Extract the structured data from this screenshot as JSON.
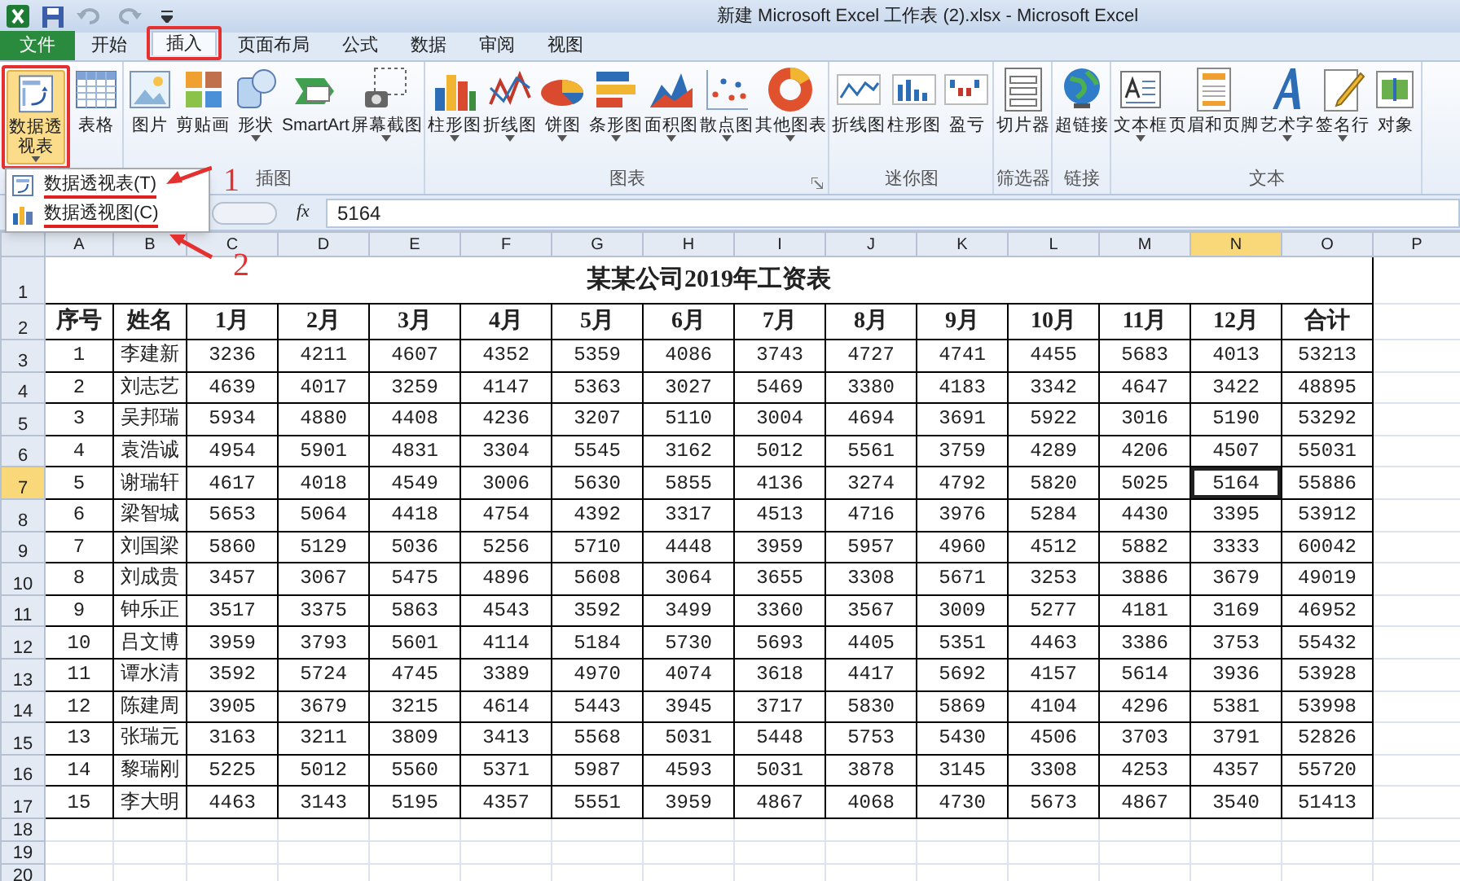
{
  "window": {
    "title": "新建 Microsoft Excel 工作表 (2).xlsx  -  Microsoft Excel"
  },
  "tabs": [
    {
      "label": "文件",
      "kind": "file",
      "selected": false
    },
    {
      "label": "开始",
      "kind": "tab",
      "selected": false
    },
    {
      "label": "插入",
      "kind": "tab",
      "selected": true
    },
    {
      "label": "页面布局",
      "kind": "tab",
      "selected": false
    },
    {
      "label": "公式",
      "kind": "tab",
      "selected": false
    },
    {
      "label": "数据",
      "kind": "tab",
      "selected": false
    },
    {
      "label": "审阅",
      "kind": "tab",
      "selected": false
    },
    {
      "label": "视图",
      "kind": "tab",
      "selected": false
    }
  ],
  "ribbon": {
    "groups": [
      {
        "buttons": [
          {
            "label": "数据透视表",
            "dropdown": true,
            "pressed": true
          },
          {
            "label": "表格",
            "dropdown": false,
            "pressed": false
          }
        ]
      },
      {
        "label": "插图",
        "buttons": [
          {
            "label": "图片",
            "dropdown": false,
            "pressed": false
          },
          {
            "label": "剪贴画",
            "dropdown": false,
            "pressed": false
          },
          {
            "label": "形状",
            "dropdown": true,
            "pressed": false
          },
          {
            "label": "SmartArt",
            "dropdown": false,
            "pressed": false
          },
          {
            "label": "屏幕截图",
            "dropdown": true,
            "pressed": false
          }
        ]
      },
      {
        "label": "图表",
        "launcher": true,
        "buttons": [
          {
            "label": "柱形图",
            "dropdown": true,
            "pressed": false
          },
          {
            "label": "折线图",
            "dropdown": true,
            "pressed": false
          },
          {
            "label": "饼图",
            "dropdown": true,
            "pressed": false
          },
          {
            "label": "条形图",
            "dropdown": true,
            "pressed": false
          },
          {
            "label": "面积图",
            "dropdown": true,
            "pressed": false
          },
          {
            "label": "散点图",
            "dropdown": true,
            "pressed": false
          },
          {
            "label": "其他图表",
            "dropdown": true,
            "pressed": false
          }
        ]
      },
      {
        "label": "迷你图",
        "buttons": [
          {
            "label": "折线图",
            "dropdown": false,
            "pressed": false
          },
          {
            "label": "柱形图",
            "dropdown": false,
            "pressed": false
          },
          {
            "label": "盈亏",
            "dropdown": false,
            "pressed": false
          }
        ]
      },
      {
        "label": "筛选器",
        "buttons": [
          {
            "label": "切片器",
            "dropdown": false,
            "pressed": false
          }
        ]
      },
      {
        "label": "链接",
        "buttons": [
          {
            "label": "超链接",
            "dropdown": false,
            "pressed": false
          }
        ]
      },
      {
        "label": "文本",
        "buttons": [
          {
            "label": "文本框",
            "dropdown": true,
            "pressed": false
          },
          {
            "label": "页眉和页脚",
            "dropdown": false,
            "pressed": false
          },
          {
            "label": "艺术字",
            "dropdown": true,
            "pressed": false
          },
          {
            "label": "签名行",
            "dropdown": true,
            "pressed": false
          },
          {
            "label": "对象",
            "dropdown": false,
            "pressed": false
          }
        ]
      }
    ]
  },
  "dropdown_menu": {
    "items": [
      {
        "label": "数据透视表(T)"
      },
      {
        "label": "数据透视图(C)"
      }
    ]
  },
  "annotations": [
    {
      "label": "1"
    },
    {
      "label": "2"
    }
  ],
  "formula_bar": {
    "function_label": "fx",
    "value": "5164"
  },
  "sheet": {
    "column_headers": [
      {
        "label": "A",
        "selected": false
      },
      {
        "label": "B",
        "selected": false
      },
      {
        "label": "C",
        "selected": false
      },
      {
        "label": "D",
        "selected": false
      },
      {
        "label": "E",
        "selected": false
      },
      {
        "label": "F",
        "selected": false
      },
      {
        "label": "G",
        "selected": false
      },
      {
        "label": "H",
        "selected": false
      },
      {
        "label": "I",
        "selected": false
      },
      {
        "label": "J",
        "selected": false
      },
      {
        "label": "K",
        "selected": false
      },
      {
        "label": "L",
        "selected": false
      },
      {
        "label": "M",
        "selected": false
      },
      {
        "label": "N",
        "selected": true
      },
      {
        "label": "O",
        "selected": false
      },
      {
        "label": "P",
        "selected": false
      }
    ],
    "row_headers": [
      {
        "label": "1",
        "selected": false
      },
      {
        "label": "2",
        "selected": false
      },
      {
        "label": "3",
        "selected": false
      },
      {
        "label": "4",
        "selected": false
      },
      {
        "label": "5",
        "selected": false
      },
      {
        "label": "6",
        "selected": false
      },
      {
        "label": "7",
        "selected": true
      },
      {
        "label": "8",
        "selected": false
      },
      {
        "label": "9",
        "selected": false
      },
      {
        "label": "10",
        "selected": false
      },
      {
        "label": "11",
        "selected": false
      },
      {
        "label": "12",
        "selected": false
      },
      {
        "label": "13",
        "selected": false
      },
      {
        "label": "14",
        "selected": false
      },
      {
        "label": "15",
        "selected": false
      },
      {
        "label": "16",
        "selected": false
      },
      {
        "label": "17",
        "selected": false
      },
      {
        "label": "18",
        "selected": false
      },
      {
        "label": "19",
        "selected": false
      },
      {
        "label": "20",
        "selected": false
      }
    ],
    "title": "某某公司2019年工资表",
    "header_row": [
      "序号",
      "姓名",
      "1月",
      "2月",
      "3月",
      "4月",
      "5月",
      "6月",
      "7月",
      "8月",
      "9月",
      "10月",
      "11月",
      "12月",
      "合计"
    ],
    "rows": [
      {
        "cells": [
          {
            "text": "1",
            "selected": false
          },
          {
            "text": "李建新",
            "selected": false
          },
          {
            "text": "3236",
            "selected": false
          },
          {
            "text": "4211",
            "selected": false
          },
          {
            "text": "4607",
            "selected": false
          },
          {
            "text": "4352",
            "selected": false
          },
          {
            "text": "5359",
            "selected": false
          },
          {
            "text": "4086",
            "selected": false
          },
          {
            "text": "3743",
            "selected": false
          },
          {
            "text": "4727",
            "selected": false
          },
          {
            "text": "4741",
            "selected": false
          },
          {
            "text": "4455",
            "selected": false
          },
          {
            "text": "5683",
            "selected": false
          },
          {
            "text": "4013",
            "selected": false
          },
          {
            "text": "53213",
            "selected": false
          }
        ]
      },
      {
        "cells": [
          {
            "text": "2",
            "selected": false
          },
          {
            "text": "刘志艺",
            "selected": false
          },
          {
            "text": "4639",
            "selected": false
          },
          {
            "text": "4017",
            "selected": false
          },
          {
            "text": "3259",
            "selected": false
          },
          {
            "text": "4147",
            "selected": false
          },
          {
            "text": "5363",
            "selected": false
          },
          {
            "text": "3027",
            "selected": false
          },
          {
            "text": "5469",
            "selected": false
          },
          {
            "text": "3380",
            "selected": false
          },
          {
            "text": "4183",
            "selected": false
          },
          {
            "text": "3342",
            "selected": false
          },
          {
            "text": "4647",
            "selected": false
          },
          {
            "text": "3422",
            "selected": false
          },
          {
            "text": "48895",
            "selected": false
          }
        ]
      },
      {
        "cells": [
          {
            "text": "3",
            "selected": false
          },
          {
            "text": "吴邦瑞",
            "selected": false
          },
          {
            "text": "5934",
            "selected": false
          },
          {
            "text": "4880",
            "selected": false
          },
          {
            "text": "4408",
            "selected": false
          },
          {
            "text": "4236",
            "selected": false
          },
          {
            "text": "3207",
            "selected": false
          },
          {
            "text": "5110",
            "selected": false
          },
          {
            "text": "3004",
            "selected": false
          },
          {
            "text": "4694",
            "selected": false
          },
          {
            "text": "3691",
            "selected": false
          },
          {
            "text": "5922",
            "selected": false
          },
          {
            "text": "3016",
            "selected": false
          },
          {
            "text": "5190",
            "selected": false
          },
          {
            "text": "53292",
            "selected": false
          }
        ]
      },
      {
        "cells": [
          {
            "text": "4",
            "selected": false
          },
          {
            "text": "袁浩诚",
            "selected": false
          },
          {
            "text": "4954",
            "selected": false
          },
          {
            "text": "5901",
            "selected": false
          },
          {
            "text": "4831",
            "selected": false
          },
          {
            "text": "3304",
            "selected": false
          },
          {
            "text": "5545",
            "selected": false
          },
          {
            "text": "3162",
            "selected": false
          },
          {
            "text": "5012",
            "selected": false
          },
          {
            "text": "5561",
            "selected": false
          },
          {
            "text": "3759",
            "selected": false
          },
          {
            "text": "4289",
            "selected": false
          },
          {
            "text": "4206",
            "selected": false
          },
          {
            "text": "4507",
            "selected": false
          },
          {
            "text": "55031",
            "selected": false
          }
        ]
      },
      {
        "cells": [
          {
            "text": "5",
            "selected": false
          },
          {
            "text": "谢瑞轩",
            "selected": false
          },
          {
            "text": "4617",
            "selected": false
          },
          {
            "text": "4018",
            "selected": false
          },
          {
            "text": "4549",
            "selected": false
          },
          {
            "text": "3006",
            "selected": false
          },
          {
            "text": "5630",
            "selected": false
          },
          {
            "text": "5855",
            "selected": false
          },
          {
            "text": "4136",
            "selected": false
          },
          {
            "text": "3274",
            "selected": false
          },
          {
            "text": "4792",
            "selected": false
          },
          {
            "text": "5820",
            "selected": false
          },
          {
            "text": "5025",
            "selected": false
          },
          {
            "text": "5164",
            "selected": true
          },
          {
            "text": "55886",
            "selected": false
          }
        ]
      },
      {
        "cells": [
          {
            "text": "6",
            "selected": false
          },
          {
            "text": "梁智城",
            "selected": false
          },
          {
            "text": "5653",
            "selected": false
          },
          {
            "text": "5064",
            "selected": false
          },
          {
            "text": "4418",
            "selected": false
          },
          {
            "text": "4754",
            "selected": false
          },
          {
            "text": "4392",
            "selected": false
          },
          {
            "text": "3317",
            "selected": false
          },
          {
            "text": "4513",
            "selected": false
          },
          {
            "text": "4716",
            "selected": false
          },
          {
            "text": "3976",
            "selected": false
          },
          {
            "text": "5284",
            "selected": false
          },
          {
            "text": "4430",
            "selected": false
          },
          {
            "text": "3395",
            "selected": false
          },
          {
            "text": "53912",
            "selected": false
          }
        ]
      },
      {
        "cells": [
          {
            "text": "7",
            "selected": false
          },
          {
            "text": "刘国梁",
            "selected": false
          },
          {
            "text": "5860",
            "selected": false
          },
          {
            "text": "5129",
            "selected": false
          },
          {
            "text": "5036",
            "selected": false
          },
          {
            "text": "5256",
            "selected": false
          },
          {
            "text": "5710",
            "selected": false
          },
          {
            "text": "4448",
            "selected": false
          },
          {
            "text": "3959",
            "selected": false
          },
          {
            "text": "5957",
            "selected": false
          },
          {
            "text": "4960",
            "selected": false
          },
          {
            "text": "4512",
            "selected": false
          },
          {
            "text": "5882",
            "selected": false
          },
          {
            "text": "3333",
            "selected": false
          },
          {
            "text": "60042",
            "selected": false
          }
        ]
      },
      {
        "cells": [
          {
            "text": "8",
            "selected": false
          },
          {
            "text": "刘成贵",
            "selected": false
          },
          {
            "text": "3457",
            "selected": false
          },
          {
            "text": "3067",
            "selected": false
          },
          {
            "text": "5475",
            "selected": false
          },
          {
            "text": "4896",
            "selected": false
          },
          {
            "text": "5608",
            "selected": false
          },
          {
            "text": "3064",
            "selected": false
          },
          {
            "text": "3655",
            "selected": false
          },
          {
            "text": "3308",
            "selected": false
          },
          {
            "text": "5671",
            "selected": false
          },
          {
            "text": "3253",
            "selected": false
          },
          {
            "text": "3886",
            "selected": false
          },
          {
            "text": "3679",
            "selected": false
          },
          {
            "text": "49019",
            "selected": false
          }
        ]
      },
      {
        "cells": [
          {
            "text": "9",
            "selected": false
          },
          {
            "text": "钟乐正",
            "selected": false
          },
          {
            "text": "3517",
            "selected": false
          },
          {
            "text": "3375",
            "selected": false
          },
          {
            "text": "5863",
            "selected": false
          },
          {
            "text": "4543",
            "selected": false
          },
          {
            "text": "3592",
            "selected": false
          },
          {
            "text": "3499",
            "selected": false
          },
          {
            "text": "3360",
            "selected": false
          },
          {
            "text": "3567",
            "selected": false
          },
          {
            "text": "3009",
            "selected": false
          },
          {
            "text": "5277",
            "selected": false
          },
          {
            "text": "4181",
            "selected": false
          },
          {
            "text": "3169",
            "selected": false
          },
          {
            "text": "46952",
            "selected": false
          }
        ]
      },
      {
        "cells": [
          {
            "text": "10",
            "selected": false
          },
          {
            "text": "吕文博",
            "selected": false
          },
          {
            "text": "3959",
            "selected": false
          },
          {
            "text": "3793",
            "selected": false
          },
          {
            "text": "5601",
            "selected": false
          },
          {
            "text": "4114",
            "selected": false
          },
          {
            "text": "5184",
            "selected": false
          },
          {
            "text": "5730",
            "selected": false
          },
          {
            "text": "5693",
            "selected": false
          },
          {
            "text": "4405",
            "selected": false
          },
          {
            "text": "5351",
            "selected": false
          },
          {
            "text": "4463",
            "selected": false
          },
          {
            "text": "3386",
            "selected": false
          },
          {
            "text": "3753",
            "selected": false
          },
          {
            "text": "55432",
            "selected": false
          }
        ]
      },
      {
        "cells": [
          {
            "text": "11",
            "selected": false
          },
          {
            "text": "谭水清",
            "selected": false
          },
          {
            "text": "3592",
            "selected": false
          },
          {
            "text": "5724",
            "selected": false
          },
          {
            "text": "4745",
            "selected": false
          },
          {
            "text": "3389",
            "selected": false
          },
          {
            "text": "4970",
            "selected": false
          },
          {
            "text": "4074",
            "selected": false
          },
          {
            "text": "3618",
            "selected": false
          },
          {
            "text": "4417",
            "selected": false
          },
          {
            "text": "5692",
            "selected": false
          },
          {
            "text": "4157",
            "selected": false
          },
          {
            "text": "5614",
            "selected": false
          },
          {
            "text": "3936",
            "selected": false
          },
          {
            "text": "53928",
            "selected": false
          }
        ]
      },
      {
        "cells": [
          {
            "text": "12",
            "selected": false
          },
          {
            "text": "陈建周",
            "selected": false
          },
          {
            "text": "3905",
            "selected": false
          },
          {
            "text": "3679",
            "selected": false
          },
          {
            "text": "3215",
            "selected": false
          },
          {
            "text": "4614",
            "selected": false
          },
          {
            "text": "5443",
            "selected": false
          },
          {
            "text": "3945",
            "selected": false
          },
          {
            "text": "3717",
            "selected": false
          },
          {
            "text": "5830",
            "selected": false
          },
          {
            "text": "5869",
            "selected": false
          },
          {
            "text": "4104",
            "selected": false
          },
          {
            "text": "4296",
            "selected": false
          },
          {
            "text": "5381",
            "selected": false
          },
          {
            "text": "53998",
            "selected": false
          }
        ]
      },
      {
        "cells": [
          {
            "text": "13",
            "selected": false
          },
          {
            "text": "张瑞元",
            "selected": false
          },
          {
            "text": "3163",
            "selected": false
          },
          {
            "text": "3211",
            "selected": false
          },
          {
            "text": "3809",
            "selected": false
          },
          {
            "text": "3413",
            "selected": false
          },
          {
            "text": "5568",
            "selected": false
          },
          {
            "text": "5031",
            "selected": false
          },
          {
            "text": "5448",
            "selected": false
          },
          {
            "text": "5753",
            "selected": false
          },
          {
            "text": "5430",
            "selected": false
          },
          {
            "text": "4506",
            "selected": false
          },
          {
            "text": "3703",
            "selected": false
          },
          {
            "text": "3791",
            "selected": false
          },
          {
            "text": "52826",
            "selected": false
          }
        ]
      },
      {
        "cells": [
          {
            "text": "14",
            "selected": false
          },
          {
            "text": "黎瑞刚",
            "selected": false
          },
          {
            "text": "5225",
            "selected": false
          },
          {
            "text": "5012",
            "selected": false
          },
          {
            "text": "5560",
            "selected": false
          },
          {
            "text": "5371",
            "selected": false
          },
          {
            "text": "5987",
            "selected": false
          },
          {
            "text": "4593",
            "selected": false
          },
          {
            "text": "5031",
            "selected": false
          },
          {
            "text": "3878",
            "selected": false
          },
          {
            "text": "3145",
            "selected": false
          },
          {
            "text": "3308",
            "selected": false
          },
          {
            "text": "4253",
            "selected": false
          },
          {
            "text": "4357",
            "selected": false
          },
          {
            "text": "55720",
            "selected": false
          }
        ]
      },
      {
        "cells": [
          {
            "text": "15",
            "selected": false
          },
          {
            "text": "李大明",
            "selected": false
          },
          {
            "text": "4463",
            "selected": false
          },
          {
            "text": "3143",
            "selected": false
          },
          {
            "text": "5195",
            "selected": false
          },
          {
            "text": "4357",
            "selected": false
          },
          {
            "text": "5551",
            "selected": false
          },
          {
            "text": "3959",
            "selected": false
          },
          {
            "text": "4867",
            "selected": false
          },
          {
            "text": "4068",
            "selected": false
          },
          {
            "text": "4730",
            "selected": false
          },
          {
            "text": "5673",
            "selected": false
          },
          {
            "text": "4867",
            "selected": false
          },
          {
            "text": "3540",
            "selected": false
          },
          {
            "text": "51413",
            "selected": false
          }
        ]
      }
    ]
  }
}
